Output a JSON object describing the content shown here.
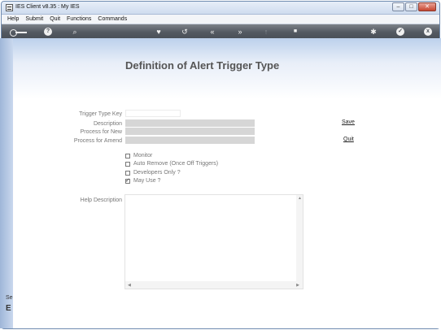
{
  "window": {
    "title": "IES Client v8.35 : My IES",
    "buttons": {
      "minimize": "–",
      "maximize": "□",
      "close": "✕"
    }
  },
  "menu": [
    "Help",
    "Submit",
    "Quit",
    "Functions",
    "Commands"
  ],
  "toolbar": {
    "icons": [
      "key-icon",
      "info-icon",
      "search-icon",
      "heart-icon",
      "undo-icon",
      "rewind-icon",
      "forward-icon",
      "upload-icon",
      "stop-icon",
      "gear-icon",
      "check-icon",
      "close-icon"
    ],
    "glyphs": {
      "info": "?",
      "search": "⌕",
      "heart": "♥",
      "undo": "↺",
      "rewind": "«",
      "forward": "»",
      "upload": "↑",
      "stop": "■",
      "gear": "✱",
      "check": "✓",
      "close": "x"
    }
  },
  "form": {
    "title": "Definition of Alert Trigger Type",
    "fields": {
      "key_label": "Trigger Type Key",
      "description_label": "Description",
      "process_new_label": "Process for New",
      "process_amend_label": "Process for Amend",
      "help_label": "Help Description"
    },
    "actions": {
      "save": "Save",
      "quit": "Quit"
    },
    "checkboxes": [
      {
        "label": "Monitor",
        "checked": false
      },
      {
        "label": "Auto Remove (Once Off Triggers)",
        "checked": false
      },
      {
        "label": "Developers Only ?",
        "checked": false
      },
      {
        "label": "May Use ?",
        "checked": true
      }
    ]
  },
  "side": {
    "text1": "Se",
    "text2": "E"
  },
  "colors": {
    "toolbar": "#545a62",
    "field_grey": "#d6d6d6",
    "title": "#555555"
  }
}
